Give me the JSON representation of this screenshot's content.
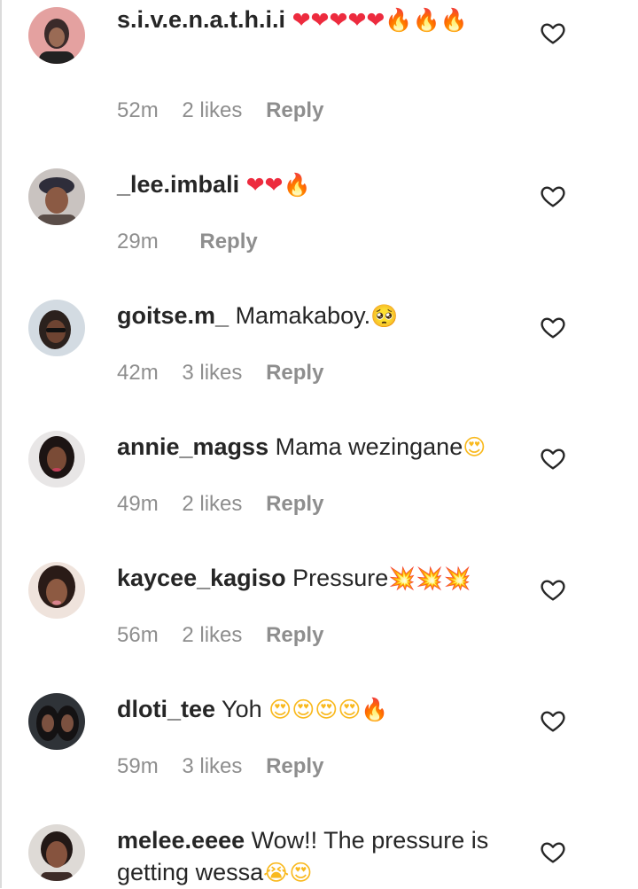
{
  "comments": [
    {
      "username": "s.i.v.e.n.a.t.h.i.i",
      "text": "",
      "emojis": [
        {
          "char": "❤",
          "name": "heart"
        },
        {
          "char": "❤",
          "name": "heart"
        },
        {
          "char": "❤",
          "name": "heart"
        },
        {
          "char": "❤",
          "name": "heart"
        },
        {
          "char": "❤",
          "name": "heart"
        },
        {
          "char": "🔥",
          "name": "fire"
        },
        {
          "char": "🔥",
          "name": "fire"
        },
        {
          "char": "🔥",
          "name": "fire"
        }
      ],
      "time": "52m",
      "likes": "2 likes",
      "reply": "Reply"
    },
    {
      "username": "_lee.imbali",
      "text": "",
      "emojis": [
        {
          "char": "❤",
          "name": "heart"
        },
        {
          "char": "❤",
          "name": "heart"
        },
        {
          "char": "🔥",
          "name": "fire"
        }
      ],
      "time": "29m",
      "likes": "",
      "reply": "Reply"
    },
    {
      "username": "goitse.m_",
      "text": "Mamakaboy.",
      "emojis": [
        {
          "char": "🥺",
          "name": "face"
        }
      ],
      "time": "42m",
      "likes": "3 likes",
      "reply": "Reply"
    },
    {
      "username": "annie_magss",
      "text": "Mama wezingane",
      "emojis": [
        {
          "char": "😍",
          "name": "face"
        }
      ],
      "time": "49m",
      "likes": "2 likes",
      "reply": "Reply"
    },
    {
      "username": "kaycee_kagiso",
      "text": "Pressure",
      "emojis": [
        {
          "char": "💥",
          "name": "boom"
        },
        {
          "char": "💥",
          "name": "boom"
        },
        {
          "char": "💥",
          "name": "boom"
        }
      ],
      "time": "56m",
      "likes": "2 likes",
      "reply": "Reply"
    },
    {
      "username": "dloti_tee",
      "text": "Yoh ",
      "emojis": [
        {
          "char": "😍",
          "name": "face"
        },
        {
          "char": "😍",
          "name": "face"
        },
        {
          "char": "😍",
          "name": "face"
        },
        {
          "char": "😍",
          "name": "face"
        },
        {
          "char": "🔥",
          "name": "fire"
        }
      ],
      "time": "59m",
      "likes": "3 likes",
      "reply": "Reply"
    },
    {
      "username": "melee.eeee",
      "text": "Wow!! The pressure is getting wessa",
      "emojis": [
        {
          "char": "😭",
          "name": "face"
        },
        {
          "char": "😍",
          "name": "face"
        }
      ],
      "time": "",
      "likes": "",
      "reply": ""
    }
  ],
  "icons": {
    "like": "heart-outline-icon"
  },
  "colors": {
    "text": "#262626",
    "meta": "#8e8e8e",
    "heart_emoji": "#ed2b3e",
    "fire_emoji": "#ff7b1a"
  }
}
